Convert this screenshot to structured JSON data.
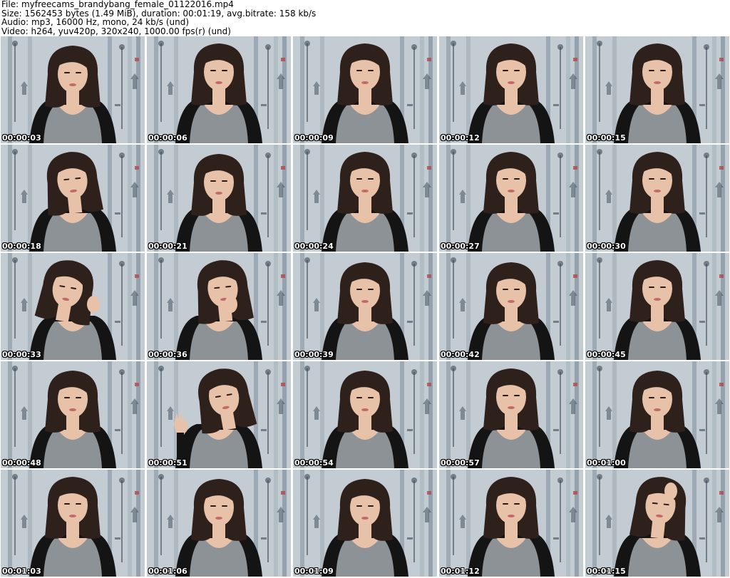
{
  "header": {
    "file": "File: myfreecams_brandybang_female_01122016.mp4",
    "size": "Size: 1562453 bytes (1.49 MiB), duration: 00:01:19, avg.bitrate: 158 kb/s",
    "audio": "Audio: mp3, 16000 Hz, mono, 24 kb/s (und)",
    "video": "Video: h264, yuv420p, 320x240, 1000.00 fps(r) (und)"
  },
  "frames": [
    {
      "ts": "00:00:03",
      "pose": "down"
    },
    {
      "ts": "00:00:06",
      "pose": "center"
    },
    {
      "ts": "00:00:09",
      "pose": "center"
    },
    {
      "ts": "00:00:12",
      "pose": "center"
    },
    {
      "ts": "00:00:15",
      "pose": "center"
    },
    {
      "ts": "00:00:18",
      "pose": "tilt"
    },
    {
      "ts": "00:00:21",
      "pose": "down"
    },
    {
      "ts": "00:00:24",
      "pose": "center"
    },
    {
      "ts": "00:00:27",
      "pose": "center"
    },
    {
      "ts": "00:00:30",
      "pose": "center"
    },
    {
      "ts": "00:00:33",
      "pose": "hand-hair-left"
    },
    {
      "ts": "00:00:36",
      "pose": "hand-hair-right"
    },
    {
      "ts": "00:00:39",
      "pose": "down"
    },
    {
      "ts": "00:00:42",
      "pose": "down"
    },
    {
      "ts": "00:00:45",
      "pose": "center"
    },
    {
      "ts": "00:00:48",
      "pose": "down"
    },
    {
      "ts": "00:00:51",
      "pose": "wave"
    },
    {
      "ts": "00:00:54",
      "pose": "down"
    },
    {
      "ts": "00:00:57",
      "pose": "center"
    },
    {
      "ts": "00:01:00",
      "pose": "down"
    },
    {
      "ts": "00:01:03",
      "pose": "center"
    },
    {
      "ts": "00:01:06",
      "pose": "down"
    },
    {
      "ts": "00:01:09",
      "pose": "down"
    },
    {
      "ts": "00:01:12",
      "pose": "center"
    },
    {
      "ts": "00:01:15",
      "pose": "hand-head"
    }
  ],
  "colors": {
    "background": "#ffffff",
    "wall": "#c4ccd3",
    "hair": "#2e211b",
    "skin": "#e8c2a8",
    "top": "#8c9296",
    "cardigan": "#141414",
    "timestamp": "#ffffff"
  }
}
